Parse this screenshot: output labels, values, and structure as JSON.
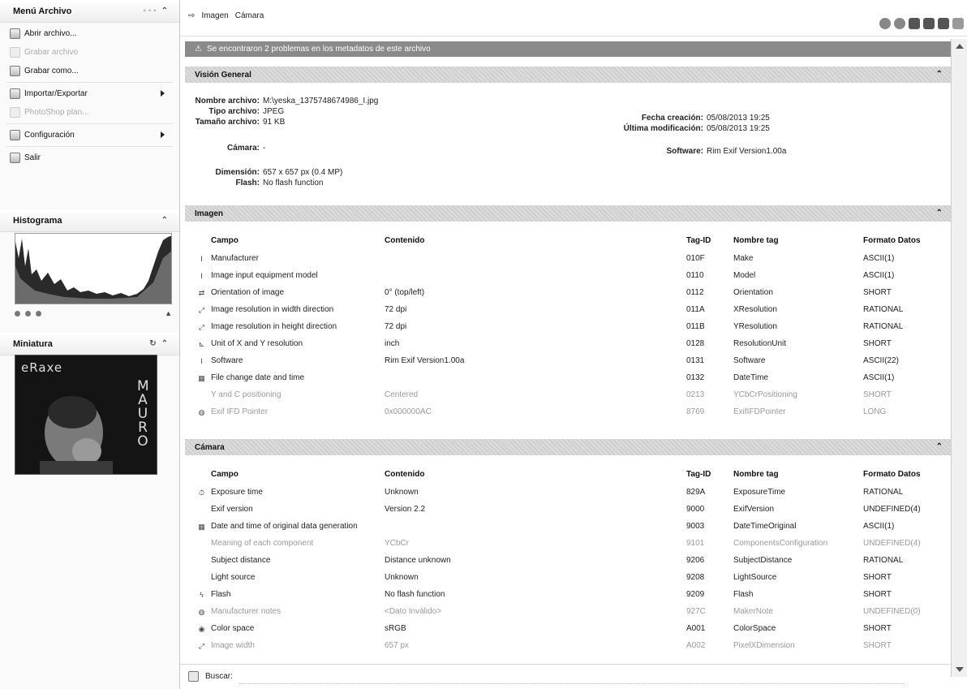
{
  "sidebar": {
    "menu_title": "Menú Archivo",
    "menu_items": [
      {
        "label": "Abrir archivo...",
        "enabled": true,
        "submenu": false
      },
      {
        "label": "Grabar archivo",
        "enabled": false,
        "submenu": false
      },
      {
        "label": "Grabar como...",
        "enabled": true,
        "submenu": false
      },
      {
        "label": "Importar/Exportar",
        "enabled": true,
        "submenu": true
      },
      {
        "label": "PhotoShop plan...",
        "enabled": false,
        "submenu": false
      },
      {
        "label": "Configuración",
        "enabled": true,
        "submenu": true
      },
      {
        "label": "Salir",
        "enabled": true,
        "submenu": false
      }
    ],
    "histogram_title": "Histograma",
    "thumbnail_title": "Miniatura",
    "thumbnail_text_top": "eRaxe",
    "thumbnail_text_side": "MAURO"
  },
  "breadcrumb": {
    "items": [
      "Imagen",
      "Cámara"
    ]
  },
  "warning": "Se encontraron 2 problemas en los metadatos de este archivo",
  "overview": {
    "title": "Visión General",
    "fields": [
      {
        "label": "Nombre archivo:",
        "value": "M:\\yeska_1375748674986_I.jpg"
      },
      {
        "label": "Tipo archivo:",
        "value": "JPEG"
      },
      {
        "label": "Tamaño archivo:",
        "value": "91 KB"
      },
      {
        "label": "Cámara:",
        "value": "-"
      },
      {
        "label": "Dimensión:",
        "value": "657 x 657 px (0.4 MP)"
      },
      {
        "label": "Flash:",
        "value": "No flash function"
      },
      {
        "label": "Fecha creación:",
        "value": "05/08/2013 19:25"
      },
      {
        "label": "Última modificación:",
        "value": "05/08/2013 19:25"
      },
      {
        "label": "Software:",
        "value": "Rim Exif Version1.00a"
      }
    ]
  },
  "columns": {
    "campo": "Campo",
    "contenido": "Contenido",
    "tagid": "Tag-ID",
    "nombre": "Nombre tag",
    "formato": "Formato Datos"
  },
  "imagen": {
    "title": "Imagen",
    "rows": [
      {
        "icon": "I",
        "campo": "Manufacturer",
        "contenido": "",
        "tagid": "010F",
        "nombre": "Make",
        "formato": "ASCII(1)",
        "dim": false
      },
      {
        "icon": "I",
        "campo": "Image input equipment model",
        "contenido": "",
        "tagid": "0110",
        "nombre": "Model",
        "formato": "ASCII(1)",
        "dim": false
      },
      {
        "icon": "⇄",
        "campo": "Orientation of image",
        "contenido": "0° (top/left)",
        "tagid": "0112",
        "nombre": "Orientation",
        "formato": "SHORT",
        "dim": false
      },
      {
        "icon": "⤢",
        "campo": "Image resolution in width direction",
        "contenido": "72 dpi",
        "tagid": "011A",
        "nombre": "XResolution",
        "formato": "RATIONAL",
        "dim": false
      },
      {
        "icon": "⤢",
        "campo": "Image resolution in height direction",
        "contenido": "72 dpi",
        "tagid": "011B",
        "nombre": "YResolution",
        "formato": "RATIONAL",
        "dim": false
      },
      {
        "icon": "⊾",
        "campo": "Unit of X and Y resolution",
        "contenido": "inch",
        "tagid": "0128",
        "nombre": "ResolutionUnit",
        "formato": "SHORT",
        "dim": false
      },
      {
        "icon": "I",
        "campo": "Software",
        "contenido": "Rim Exif Version1.00a",
        "tagid": "0131",
        "nombre": "Software",
        "formato": "ASCII(22)",
        "dim": false
      },
      {
        "icon": "▦",
        "campo": "File change date and time",
        "contenido": "",
        "tagid": "0132",
        "nombre": "DateTime",
        "formato": "ASCII(1)",
        "dim": false
      },
      {
        "icon": "",
        "campo": "Y and C positioning",
        "contenido": "Centered",
        "tagid": "0213",
        "nombre": "YCbCrPositioning",
        "formato": "SHORT",
        "dim": true
      },
      {
        "icon": "◍",
        "campo": "Exif IFD Pointer",
        "contenido": "0x000000AC",
        "tagid": "8769",
        "nombre": "ExifIFDPointer",
        "formato": "LONG",
        "dim": true
      }
    ]
  },
  "camara": {
    "title": "Cámara",
    "rows": [
      {
        "icon": "⏱",
        "campo": "Exposure time",
        "contenido": "Unknown",
        "tagid": "829A",
        "nombre": "ExposureTime",
        "formato": "RATIONAL",
        "dim": false
      },
      {
        "icon": "",
        "campo": "Exif version",
        "contenido": "Version 2.2",
        "tagid": "9000",
        "nombre": "ExifVersion",
        "formato": "UNDEFINED(4)",
        "dim": false
      },
      {
        "icon": "▦",
        "campo": "Date and time of original data generation",
        "contenido": "",
        "tagid": "9003",
        "nombre": "DateTimeOriginal",
        "formato": "ASCII(1)",
        "dim": false
      },
      {
        "icon": "",
        "campo": "Meaning of each component",
        "contenido": "YCbCr",
        "tagid": "9101",
        "nombre": "ComponentsConfiguration",
        "formato": "UNDEFINED(4)",
        "dim": true
      },
      {
        "icon": "",
        "campo": "Subject distance",
        "contenido": "Distance unknown",
        "tagid": "9206",
        "nombre": "SubjectDistance",
        "formato": "RATIONAL",
        "dim": false
      },
      {
        "icon": "",
        "campo": "Light source",
        "contenido": "Unknown",
        "tagid": "9208",
        "nombre": "LightSource",
        "formato": "SHORT",
        "dim": false
      },
      {
        "icon": "ϟ",
        "campo": "Flash",
        "contenido": "No flash function",
        "tagid": "9209",
        "nombre": "Flash",
        "formato": "SHORT",
        "dim": false
      },
      {
        "icon": "◍",
        "campo": "Manufacturer notes",
        "contenido": "<Dato Inválido>",
        "tagid": "927C",
        "nombre": "MakerNote",
        "formato": "UNDEFINED(0)",
        "dim": true
      },
      {
        "icon": "◉",
        "campo": "Color space",
        "contenido": "sRGB",
        "tagid": "A001",
        "nombre": "ColorSpace",
        "formato": "SHORT",
        "dim": false
      },
      {
        "icon": "⤢",
        "campo": "Image width",
        "contenido": "657 px",
        "tagid": "A002",
        "nombre": "PixelXDimension",
        "formato": "SHORT",
        "dim": true
      }
    ]
  },
  "search": {
    "label": "Buscar:",
    "value": ""
  }
}
